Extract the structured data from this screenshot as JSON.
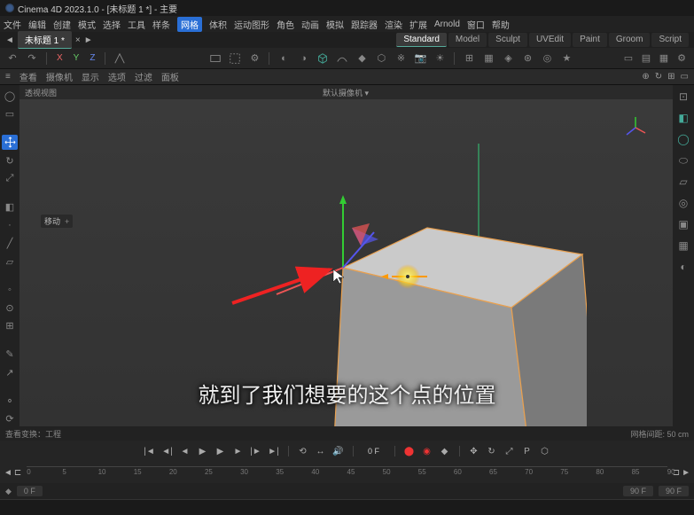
{
  "titlebar": {
    "title": "Cinema 4D 2023.1.0 - [未标题 1 *] - 主要"
  },
  "doc_tab": "未标题 1 *",
  "menu": [
    "文件",
    "编辑",
    "创建",
    "模式",
    "选择",
    "工具",
    "样条",
    "网格",
    "体积",
    "运动图形",
    "角色",
    "动画",
    "模拟",
    "跟踪器",
    "渲染",
    "扩展",
    "Arnold",
    "窗口",
    "帮助"
  ],
  "menu_hl_index": 7,
  "layout_tabs": [
    "Standard",
    "Model",
    "Sculpt",
    "UVEdit",
    "Paint",
    "Groom",
    "Script"
  ],
  "layout_active": 0,
  "axes": [
    "X",
    "Y",
    "Z"
  ],
  "sub_menu": [
    "查看",
    "摄像机",
    "显示",
    "选项",
    "过滤",
    "面板"
  ],
  "viewport": {
    "label": "透视视图",
    "camera": "默认摄像机 ▾",
    "grid_label": "网格间距: 50 cm"
  },
  "move_label": "移动",
  "status": {
    "left": "查看变换：工程"
  },
  "timeline": {
    "ticks": [
      0,
      5,
      10,
      15,
      20,
      25,
      30,
      35,
      40,
      45,
      50,
      55,
      60,
      65,
      70,
      75,
      80,
      85,
      90
    ],
    "frame": "0 F",
    "start": "0 F",
    "end": "90 F",
    "end2": "90 F"
  },
  "subtitle": "就到了我们想要的这个点的位置"
}
